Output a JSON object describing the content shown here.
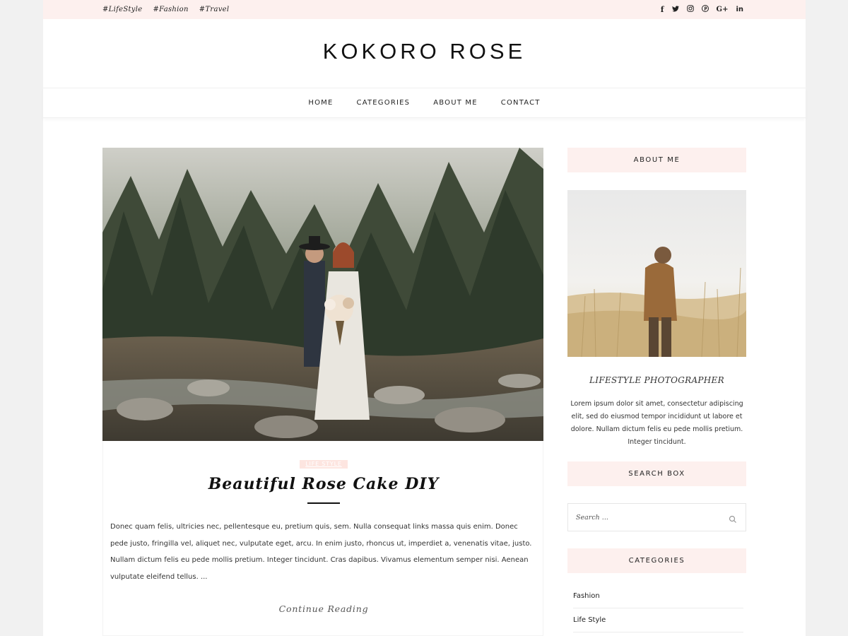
{
  "topbar": {
    "tags": [
      "#LifeStyle",
      "#Fashion",
      "#Travel"
    ],
    "social_icons": [
      {
        "name": "facebook-icon",
        "glyph": "f"
      },
      {
        "name": "twitter-icon",
        "glyph": "🐦"
      },
      {
        "name": "instagram-icon",
        "glyph": "◎"
      },
      {
        "name": "pinterest-icon",
        "glyph": "℗"
      },
      {
        "name": "google-plus-icon",
        "glyph": "G+"
      },
      {
        "name": "linkedin-icon",
        "glyph": "in"
      }
    ]
  },
  "site": {
    "title": "KOKORO ROSE"
  },
  "nav": {
    "items": [
      "HOME",
      "CATEGORIES",
      "ABOUT ME",
      "CONTACT"
    ]
  },
  "post": {
    "category": "LIFE STYLE",
    "title": "Beautiful Rose Cake DIY",
    "excerpt": "Donec quam felis, ultricies nec, pellentesque eu, pretium quis, sem. Nulla consequat links massa quis enim. Donec pede justo, fringilla vel, aliquet nec, vulputate eget, arcu. In enim justo, rhoncus ut, imperdiet a, venenatis vitae, justo. Nullam dictum felis eu pede mollis pretium. Integer tincidunt. Cras dapibus. Vivamus elementum semper nisi. Aenean vulputate eleifend tellus. ...",
    "continue_label": "Continue Reading"
  },
  "sidebar": {
    "about": {
      "title": "ABOUT ME",
      "subtitle": "LIFESTYLE PHOTOGRAPHER",
      "text": "Lorem ipsum dolor sit amet, consectetur adipiscing elit, sed do eiusmod tempor incididunt ut labore et dolore. Nullam dictum felis eu pede mollis pretium. Integer tincidunt."
    },
    "search": {
      "title": "SEARCH BOX",
      "placeholder": "Search ..."
    },
    "categories": {
      "title": "CATEGORIES",
      "items": [
        "Fashion",
        "Life Style"
      ]
    }
  },
  "colors": {
    "accent_bg": "#fdf0ee",
    "badge_bg": "#fde5e0"
  }
}
